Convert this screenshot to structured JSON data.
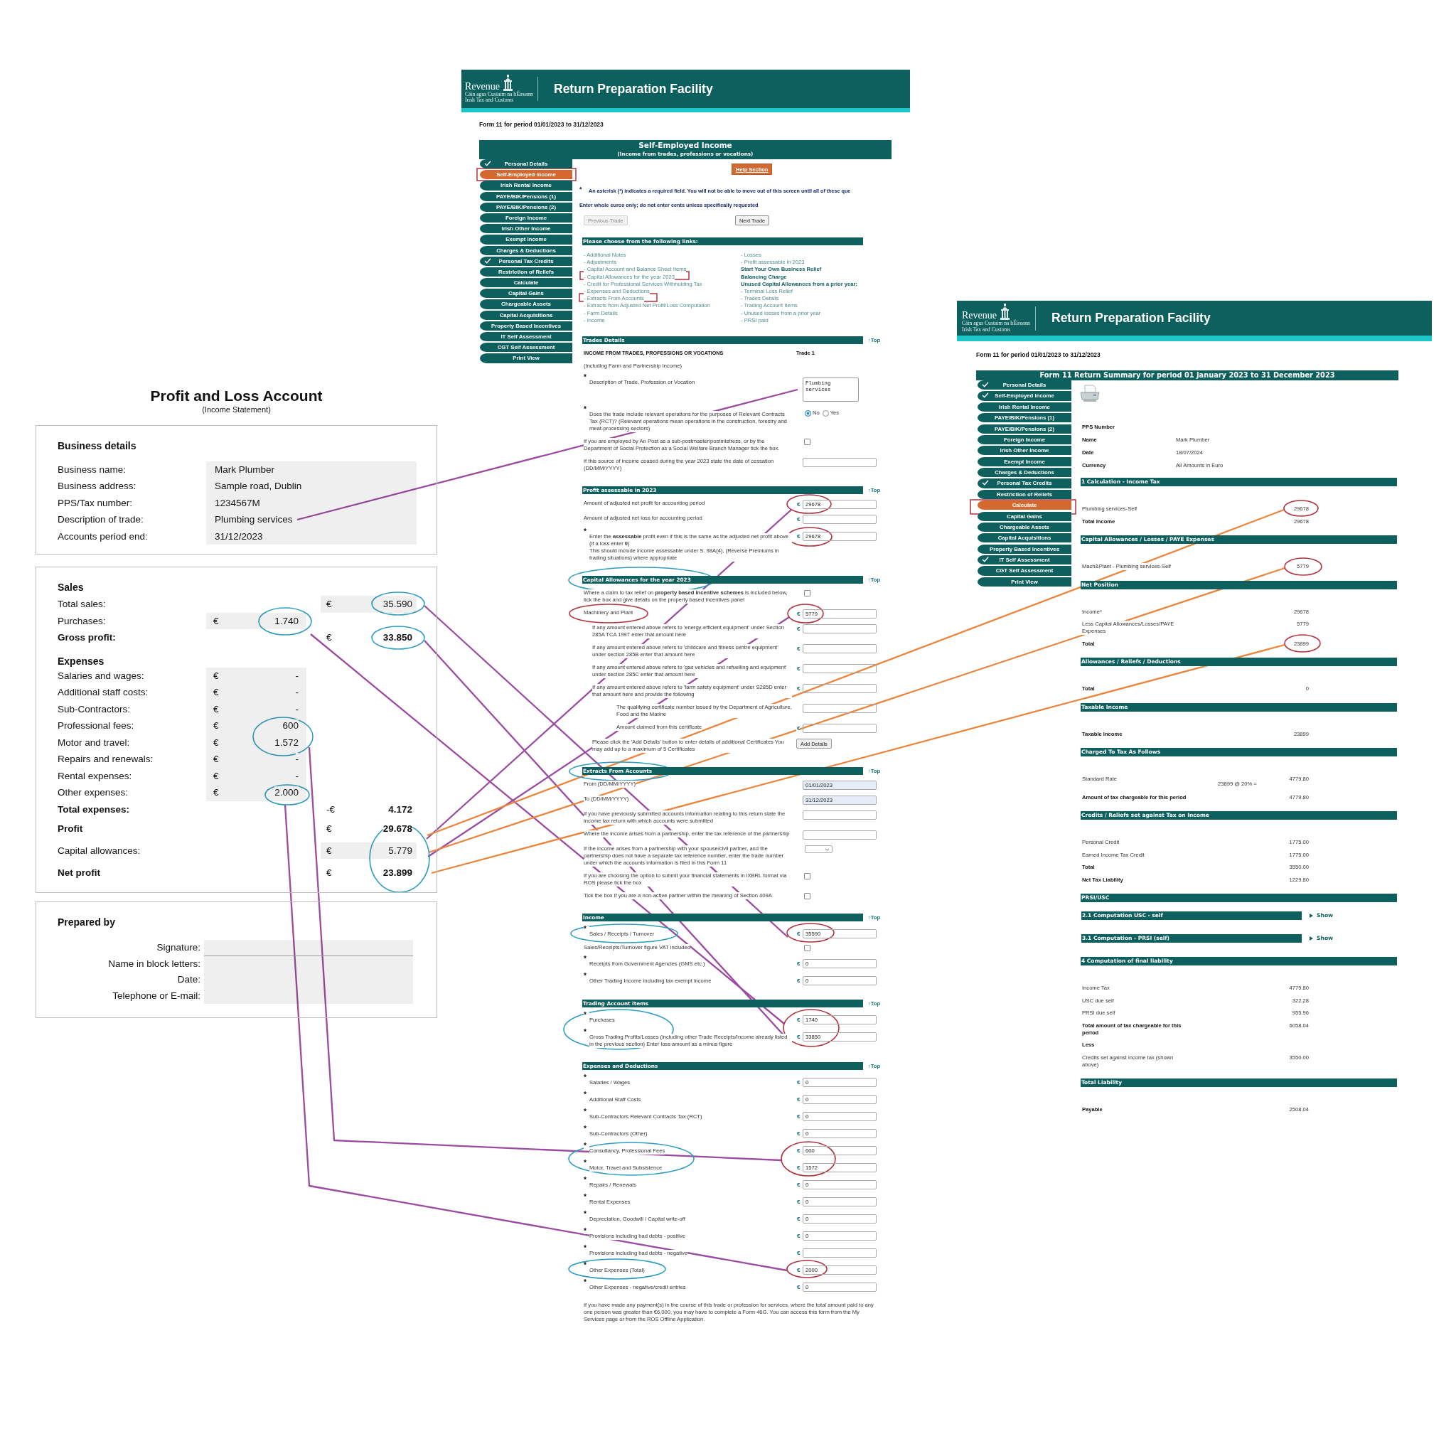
{
  "profit_and_loss": {
    "title": "Profit and Loss Account",
    "subtitle": "(Income Statement)",
    "business_details": {
      "heading": "Business details",
      "rows": [
        {
          "label": "Business name:",
          "value": "Mark Plumber"
        },
        {
          "label": "Business address:",
          "value": "Sample road, Dublin"
        },
        {
          "label": "PPS/Tax number:",
          "value": "1234567M"
        },
        {
          "label": "Description of trade:",
          "value": "Plumbing services"
        },
        {
          "label": "Accounts period end:",
          "value": "31/12/2023"
        }
      ]
    },
    "accounts": [
      {
        "kind": "section",
        "heading": "Sales",
        "rows": [
          {
            "kind": "summary",
            "label": "Total sales:",
            "currency": "€",
            "value": "35.590",
            "shaded": true,
            "strong": false
          },
          {
            "kind": "detail",
            "label": "Purchases:",
            "currency": "€",
            "value": "1.740",
            "shaded": true,
            "strong": false
          },
          {
            "kind": "summary",
            "label": "Gross profit:",
            "currency": "€",
            "value": "33.850",
            "shaded": false,
            "strong": true
          }
        ]
      },
      {
        "kind": "section",
        "heading": "Expenses",
        "rows": [
          {
            "kind": "detail",
            "label": "Salaries and wages:",
            "currency": "€",
            "value": "-",
            "shaded": true,
            "strong": false
          },
          {
            "kind": "detail",
            "label": "Additional staff costs:",
            "currency": "€",
            "value": "-",
            "shaded": true,
            "strong": false
          },
          {
            "kind": "detail",
            "label": "Sub-Contractors:",
            "currency": "€",
            "value": "-",
            "shaded": true,
            "strong": false
          },
          {
            "kind": "detail",
            "label": "Professional fees:",
            "currency": "€",
            "value": "600",
            "shaded": true,
            "strong": false
          },
          {
            "kind": "detail",
            "label": "Motor and travel:",
            "currency": "€",
            "value": "1.572",
            "shaded": true,
            "strong": false
          },
          {
            "kind": "detail",
            "label": "Repairs and renewals:",
            "currency": "€",
            "value": "-",
            "shaded": true,
            "strong": false
          },
          {
            "kind": "detail",
            "label": "Rental expenses:",
            "currency": "€",
            "value": "-",
            "shaded": true,
            "strong": false
          },
          {
            "kind": "detail",
            "label": "Other expenses:",
            "currency": "€",
            "value": "2.000",
            "shaded": true,
            "strong": false
          },
          {
            "kind": "summary",
            "label": "Total expenses:",
            "currency": "-€",
            "value": "4.172",
            "shaded": false,
            "strong": true
          }
        ]
      },
      {
        "kind": "result",
        "rows": [
          {
            "kind": "summary",
            "label": "Profit",
            "currency": "€",
            "value": "29.678",
            "shaded": false,
            "strong": true
          },
          {
            "kind": "summary",
            "label": "Capital allowances:",
            "currency": "€",
            "value": "5.779",
            "shaded": true,
            "strong": false
          },
          {
            "kind": "summary",
            "label": "Net profit",
            "currency": "€",
            "value": "23.899",
            "shaded": false,
            "strong": true
          }
        ]
      }
    ],
    "prepared_by": {
      "heading": "Prepared by",
      "fields": [
        {
          "kind": "signature",
          "label": "Signature:"
        },
        {
          "kind": "text",
          "label": "Name in block letters:"
        },
        {
          "kind": "text",
          "label": "Date:"
        },
        {
          "kind": "text",
          "label": "Telephone or E-mail:"
        }
      ]
    }
  },
  "form_page": {
    "logo": {
      "name": "Revenue",
      "tagline_1": "Cáin agus Custaim na hÉireann",
      "tagline_2": "Irish Tax and Customs"
    },
    "app_title": "Return Preparation Facility",
    "period": "Form 11 for period 01/01/2023 to 31/12/2023",
    "section_title": "Self-Employed Income",
    "section_subtitle": "(Income from trades, professions or vocations)",
    "sidebar": [
      {
        "label": "Personal Details",
        "done": true,
        "selected": false
      },
      {
        "label": "Self-Employed Income",
        "done": false,
        "selected": true
      },
      {
        "label": "Irish Rental Income",
        "done": false,
        "selected": false
      },
      {
        "label": "PAYE/BIK/Pensions (1)",
        "done": false,
        "selected": false
      },
      {
        "label": "PAYE/BIK/Pensions (2)",
        "done": false,
        "selected": false
      },
      {
        "label": "Foreign Income",
        "done": false,
        "selected": false
      },
      {
        "label": "Irish Other Income",
        "done": false,
        "selected": false
      },
      {
        "label": "Exempt Income",
        "done": false,
        "selected": false
      },
      {
        "label": "Charges & Deductions",
        "done": false,
        "selected": false
      },
      {
        "label": "Personal Tax Credits",
        "done": true,
        "selected": false
      },
      {
        "label": "Restriction of Reliefs",
        "done": false,
        "selected": false
      },
      {
        "label": "Calculate",
        "done": false,
        "selected": false
      },
      {
        "label": "Capital Gains",
        "done": false,
        "selected": false
      },
      {
        "label": "Chargeable Assets",
        "done": false,
        "selected": false
      },
      {
        "label": "Capital Acquisitions",
        "done": false,
        "selected": false
      },
      {
        "label": "Property Based Incentives",
        "done": false,
        "selected": false
      },
      {
        "label": "IT Self Assessment",
        "done": false,
        "selected": false
      },
      {
        "label": "CGT Self Assessment",
        "done": false,
        "selected": false
      },
      {
        "label": "Print View",
        "done": false,
        "selected": false
      }
    ],
    "help_button": "Help Section",
    "required_note": {
      "marker": "*",
      "text": "An asterisk (*) indicates a required field. You will not be able to move out of this screen until all of these que"
    },
    "euro_note": "Enter whole euros only; do not enter cents unless specifically requested",
    "trade_buttons": [
      {
        "label": "Previous Trade",
        "disabled": true
      },
      {
        "label": "Next Trade",
        "disabled": false
      }
    ],
    "links": {
      "heading": "Please choose from the following links:",
      "columns": [
        [
          {
            "kind": "link",
            "text": "- Additional Notes"
          },
          {
            "kind": "link",
            "text": "- Adjustments"
          },
          {
            "kind": "link",
            "text": "- Capital Account and Balance Sheet Items"
          },
          {
            "kind": "link",
            "text": "- Capital Allowances for the year 2023"
          },
          {
            "kind": "link",
            "text": "- Credit for Professional Services Withholding Tax"
          },
          {
            "kind": "link",
            "text": "- Expenses and Deductions"
          },
          {
            "kind": "link",
            "text": "- Extracts From Accounts"
          },
          {
            "kind": "link",
            "text": "- Extracts from Adjusted Net Profit/Loss Computation"
          },
          {
            "kind": "link",
            "text": "- Farm Details"
          },
          {
            "kind": "link",
            "text": "- Income"
          }
        ],
        [
          {
            "kind": "link",
            "text": "- Losses"
          },
          {
            "kind": "link",
            "text": "- Profit assessable in 2023"
          },
          {
            "kind": "heading",
            "text": "Start Your Own Business Relief"
          },
          {
            "kind": "heading",
            "text": "Balancing Charge"
          },
          {
            "kind": "heading",
            "text": "Unused Capital Allowances from a prior year:"
          },
          {
            "kind": "link",
            "text": "- Terminal Loss Relief"
          },
          {
            "kind": "link",
            "text": "- Trades Details"
          },
          {
            "kind": "link",
            "text": "- Trading Account Items"
          },
          {
            "kind": "link",
            "text": "- Unused losses from a prior year"
          },
          {
            "kind": "link",
            "text": "- PRSI paid"
          }
        ]
      ]
    },
    "sections": [
      {
        "title": "Trades Details",
        "top_link": "↑Top",
        "rows": [
          {
            "kind": "heading",
            "label": "INCOME FROM TRADES, PROFESSIONS OR VOCATIONS",
            "value": "Trade 1"
          },
          {
            "kind": "plain",
            "label": "(Including Farm and Partnership Income)"
          },
          {
            "kind": "textarea",
            "marker": "*",
            "label": "Description of Trade, Profession or Vocation",
            "value": "Plumbing services"
          },
          {
            "kind": "radio",
            "marker": "*",
            "label": "Does the trade include relevant operations for the purposes of Relevant Contracts Tax (RCT)? (Relevant operations mean operations in the construction, forestry and meat-processing sectors)",
            "options": [
              {
                "label": "No",
                "selected": true
              },
              {
                "label": "Yes",
                "selected": false
              }
            ]
          },
          {
            "kind": "checkbox",
            "label": "If you are employed by An Post as a sub-postmaster/postmistress, or by the Department of Social Protection as a Social Welfare Branch Manager tick the box.",
            "checked": false
          },
          {
            "kind": "input",
            "label": "If this source of income ceased during the year 2023 state the date of cessation (DD/MM/YYYY)"
          }
        ]
      },
      {
        "title": "Profit assessable in 2023",
        "top_link": "↑Top",
        "rows": [
          {
            "kind": "input",
            "label": "Amount of adjusted net profit for accounting period",
            "currency": "€",
            "value": "29678"
          },
          {
            "kind": "input",
            "label": "Amount of adjusted net loss for accounting period",
            "currency": "€"
          },
          {
            "kind": "input",
            "marker": "*",
            "label": "Enter the **assessable** profit even if this is the same as the adjusted net profit above (if a loss enter **0**)",
            "note": "This should include income assessable under S. 98A(4), (Reverse Premiums in trading situations) where appropriate",
            "currency": "€",
            "value": "29678"
          }
        ]
      },
      {
        "title": "Capital Allowances for the year 2023",
        "top_link": "↑Top",
        "rows": [
          {
            "kind": "checkbox",
            "label": "Where a claim to tax relief on **property based incentive schemes** is included below, tick the box and give details on the property based incentives panel",
            "checked": false
          },
          {
            "kind": "input",
            "label": "Machinery and Plant",
            "currency": "€",
            "value": "5779",
            "children": [
              {
                "kind": "input",
                "label": "If any amount entered above refers to 'energy-efficient equipment' under Section 285A TCA 1997 enter that amount here",
                "currency": "€"
              },
              {
                "kind": "input",
                "label": "If any amount entered above refers to 'childcare and fitness centre equipment' under section 285B enter that amount here",
                "currency": "€"
              },
              {
                "kind": "input",
                "label": "If any amount entered above refers to 'gas vehicles and refuelling and equipment' under section 285C enter that amount here",
                "currency": "€"
              },
              {
                "kind": "input",
                "label": "If any amount entered above refers to 'farm safety equipment' under S285D enter that amount here and provide the following",
                "currency": "€",
                "children": [
                  {
                    "kind": "input",
                    "label": "The qualifying certificate number issued by the Department of Agriculture, Food and the Marine"
                  },
                  {
                    "kind": "input",
                    "label": "Amount claimed from this certificate",
                    "currency": "€"
                  }
                ]
              },
              {
                "kind": "button",
                "label": "Please click the 'Add Details' button to enter details of additional Certificates You may add up to a maximum of 5 Certificates",
                "value": "Add Details"
              }
            ]
          }
        ]
      },
      {
        "title": "Extracts From Accounts",
        "top_link": "↑Top",
        "rows": [
          {
            "kind": "date",
            "label": "From (DD/MM/YYYY)",
            "value": "01/01/2023"
          },
          {
            "kind": "date",
            "label": "To (DD/MM/YYYY)",
            "value": "31/12/2023"
          },
          {
            "kind": "input",
            "label": "If you have previously submitted accounts information relating to this return state the income tax return with which accounts were submitted"
          },
          {
            "kind": "input",
            "label": "Where the income arises from a partnership, enter the tax reference of the partnership"
          },
          {
            "kind": "select",
            "label": "If the income arises from a partnership with your spouse/civil partner, and the partnership does not have a separate tax reference number, enter the trade number under which the accounts information is filed in this Form 11"
          },
          {
            "kind": "checkbox",
            "label": "If you are choosing the option to submit your financial statements in iXBRL format via ROS please tick the box",
            "checked": false
          },
          {
            "kind": "checkbox",
            "label": "Tick the box if you are a non-active partner within the meaning of Section 409A",
            "checked": false
          }
        ]
      },
      {
        "title": "Income",
        "top_link": "↑Top",
        "rows": [
          {
            "kind": "input",
            "marker": "*",
            "label": "Sales / Receipts / Turnover",
            "currency": "€",
            "value": "35590"
          },
          {
            "kind": "checkbox",
            "label": "Sales/Receipts/Turnover figure VAT included",
            "checked": false
          },
          {
            "kind": "input",
            "marker": "*",
            "label": "Receipts from Government Agencies (GMS etc.)",
            "currency": "€",
            "value": "0"
          },
          {
            "kind": "input",
            "marker": "*",
            "label": "Other Trading Income including tax exempt income",
            "currency": "€",
            "value": "0"
          }
        ]
      },
      {
        "title": "Trading Account Items",
        "top_link": "↑Top",
        "rows": [
          {
            "kind": "input",
            "marker": "*",
            "label": "Purchases",
            "currency": "€",
            "value": "1740"
          },
          {
            "kind": "input",
            "marker": "*",
            "label": "Gross Trading Profits/Losses (including other Trade Receipts/Income already listed in the previous section) Enter loss amount as a minus figure",
            "currency": "€",
            "value": "33850"
          }
        ]
      },
      {
        "title": "Expenses and Deductions",
        "top_link": "↑Top",
        "rows": [
          {
            "kind": "input",
            "marker": "*",
            "label": "Salaries / Wages",
            "currency": "€",
            "value": "0"
          },
          {
            "kind": "input",
            "marker": "*",
            "label": "Additional Staff Costs",
            "currency": "€",
            "value": "0"
          },
          {
            "kind": "input",
            "marker": "*",
            "label": "Sub-Contractors Relevant Contracts Tax (RCT)",
            "currency": "€",
            "value": "0"
          },
          {
            "kind": "input",
            "marker": "*",
            "label": "Sub-Contractors (Other)",
            "currency": "€",
            "value": "0"
          },
          {
            "kind": "input",
            "marker": "*",
            "label": "Consultancy, Professional Fees",
            "currency": "€",
            "value": "600"
          },
          {
            "kind": "input",
            "marker": "*",
            "label": "Motor, Travel and Subsistence",
            "currency": "€",
            "value": "1572"
          },
          {
            "kind": "input",
            "marker": "*",
            "label": "Repairs / Renewals",
            "currency": "€",
            "value": "0"
          },
          {
            "kind": "input",
            "marker": "*",
            "label": "Rental Expenses",
            "currency": "€",
            "value": "0"
          },
          {
            "kind": "input",
            "marker": "*",
            "label": "Depreciation, Goodwill / Capital write-off",
            "currency": "€",
            "value": "0"
          },
          {
            "kind": "input",
            "marker": "*",
            "label": "Provisions including bad debts - positive",
            "currency": "€",
            "value": "0"
          },
          {
            "kind": "input",
            "marker": "*",
            "label": "Provisions including bad debts - negative",
            "currency": "€"
          },
          {
            "kind": "input",
            "marker": "*",
            "label": "Other Expenses (Total)",
            "currency": "€",
            "value": "2000"
          },
          {
            "kind": "input",
            "marker": "*",
            "label": "Other Expenses - negative/credit entries",
            "currency": "€",
            "value": "0"
          }
        ]
      }
    ],
    "footer_note": "If you have made any payment(s) in the course of this trade or profession for services, where the total amount paid to any one person was greater than €6,000, you may have to complete a Form 46G. You can access this form from the My Services page or from the ROS Offline Application."
  },
  "summary_page": {
    "logo": {
      "name": "Revenue",
      "tagline_1": "Cáin agus Custaim na hÉireann",
      "tagline_2": "Irish Tax and Customs"
    },
    "app_title": "Return Preparation Facility",
    "period": "Form 11 for period 01/01/2023 to 31/12/2023",
    "title": "Form 11 Return Summary for period 01 January 2023 to 31 December 2023",
    "sidebar": [
      {
        "label": "Personal Details",
        "done": true,
        "selected": false
      },
      {
        "label": "Self-Employed Income",
        "done": true,
        "selected": false
      },
      {
        "label": "Irish Rental Income",
        "done": false,
        "selected": false
      },
      {
        "label": "PAYE/BIK/Pensions (1)",
        "done": false,
        "selected": false
      },
      {
        "label": "PAYE/BIK/Pensions (2)",
        "done": false,
        "selected": false
      },
      {
        "label": "Foreign Income",
        "done": false,
        "selected": false
      },
      {
        "label": "Irish Other Income",
        "done": false,
        "selected": false
      },
      {
        "label": "Exempt Income",
        "done": false,
        "selected": false
      },
      {
        "label": "Charges & Deductions",
        "done": false,
        "selected": false
      },
      {
        "label": "Personal Tax Credits",
        "done": true,
        "selected": false
      },
      {
        "label": "Restriction of Reliefs",
        "done": false,
        "selected": false
      },
      {
        "label": "Calculate",
        "done": false,
        "selected": true
      },
      {
        "label": "Capital Gains",
        "done": false,
        "selected": false
      },
      {
        "label": "Chargeable Assets",
        "done": false,
        "selected": false
      },
      {
        "label": "Capital Acquisitions",
        "done": false,
        "selected": false
      },
      {
        "label": "Property Based Incentives",
        "done": false,
        "selected": false
      },
      {
        "label": "IT Self Assessment",
        "done": true,
        "selected": false
      },
      {
        "label": "CGT Self Assessment",
        "done": false,
        "selected": false
      },
      {
        "label": "Print View",
        "done": false,
        "selected": false
      }
    ],
    "details": [
      {
        "label": "PPS Number"
      },
      {
        "label": "Name",
        "value": "Mark Plumber"
      },
      {
        "label": "Date",
        "value": "18/07/2024"
      },
      {
        "label": "Currency",
        "value": "All Amounts in Euro"
      }
    ],
    "sections": [
      {
        "title": "1 Calculation - Income Tax",
        "rows": [
          {
            "label": "Plumbing services-Self",
            "value": "29678",
            "strong": false
          },
          {
            "label": "Total Income",
            "value": "29678",
            "strong": true
          }
        ]
      },
      {
        "title": "Capital Allowances / Losses / PAYE Expenses",
        "rows": [
          {
            "label": "Mach&Plant - Plumbing services-Self",
            "value": "5779",
            "strong": false
          }
        ]
      },
      {
        "title": "Net Position",
        "rows": [
          {
            "label": "Income*",
            "value": "29678",
            "strong": false
          },
          {
            "label": "Less Capital Allowances/Losses/PAYE Expenses",
            "value": "5779",
            "strong": false
          },
          {
            "label": "Total",
            "value": "23899",
            "strong": true
          }
        ]
      },
      {
        "title": "Allowances / Reliefs / Deductions",
        "rows": [
          {
            "label": "Total",
            "value": "0",
            "strong": true
          }
        ]
      },
      {
        "title": "Taxable Income",
        "rows": [
          {
            "label": "Taxable Income",
            "value": "23899",
            "strong": true
          }
        ]
      },
      {
        "title": "Charged To Tax As Follows",
        "rows": [
          {
            "label": "Standard Rate",
            "calculation": "23899 @ 20% =",
            "value": "4779.80",
            "strong": false
          },
          {
            "label": "Amount of tax chargeable for this period",
            "value": "4779.80",
            "strong": true
          }
        ]
      },
      {
        "title": "Credits / Reliefs set against Tax on Income",
        "rows": [
          {
            "label": "Personal Credit",
            "value": "1775.00",
            "strong": false
          },
          {
            "label": "Earned Income Tax Credit",
            "value": "1775.00",
            "strong": false
          },
          {
            "label": "Total",
            "value": "3550.00",
            "strong": true
          },
          {
            "label": "Net Tax Liability",
            "value": "1229.80",
            "strong": true
          }
        ]
      },
      {
        "title": "PRSI/USC",
        "subsections": [
          {
            "title": "2.1 Computation USC - self",
            "toggle": "Show",
            "expanded": false
          },
          {
            "title": "3.1 Computation - PRSI (self)",
            "toggle": "Show",
            "expanded": false
          }
        ]
      },
      {
        "title": "4 Computation of final liability",
        "rows": [
          {
            "label": "Income Tax",
            "value": "4779.80",
            "strong": false
          },
          {
            "label": "USC due self",
            "value": "322.28",
            "strong": false
          },
          {
            "label": "PRSI due self",
            "value": "955.96",
            "strong": false
          },
          {
            "label": "Total amount of tax chargeable for this period",
            "value": "6058.04",
            "strong": true
          },
          {
            "label": "Less",
            "strong": true
          },
          {
            "label": "Credits set against income tax (shown above)",
            "value": "3550.00",
            "strong": false
          }
        ]
      },
      {
        "title": "Total Liability",
        "rows": [
          {
            "label": "Payable",
            "value": "2508.04",
            "strong": true
          }
        ]
      }
    ]
  }
}
